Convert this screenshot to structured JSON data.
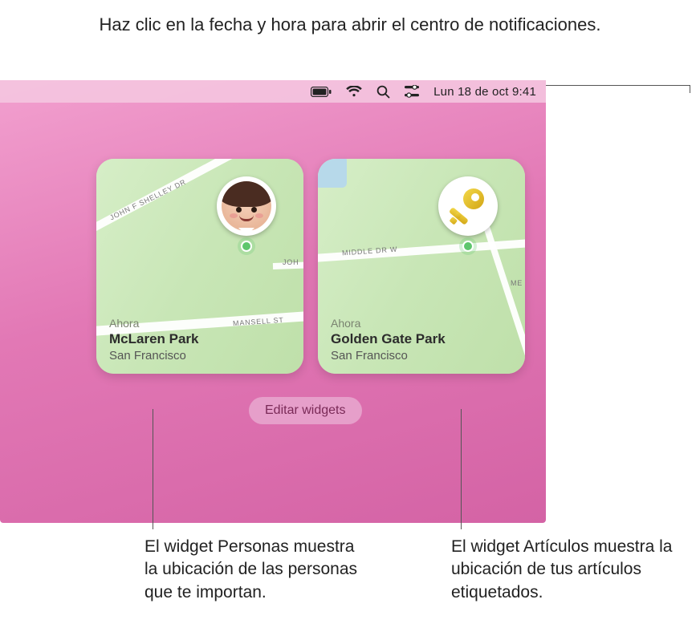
{
  "callouts": {
    "top": "Haz clic en la fecha y hora para abrir el centro de notificaciones.",
    "bottom_left": "El widget Personas muestra la ubicación de las personas que te importan.",
    "bottom_right": "El widget Artículos muestra la ubicación de tus artículos etiquetados."
  },
  "menubar": {
    "datetime": "Lun 18 de oct  9:41",
    "icons": {
      "battery": "battery-icon",
      "wifi": "wifi-icon",
      "search": "search-icon",
      "control_center": "control-center-icon"
    }
  },
  "widgets": {
    "people": {
      "now_label": "Ahora",
      "place": "McLaren Park",
      "city": "San Francisco",
      "roads": {
        "r1": "JOHN F SHELLEY DR",
        "r2": "MANSELL ST",
        "r3": "JOH"
      },
      "pin_icon": "memoji-person-icon"
    },
    "items": {
      "now_label": "Ahora",
      "place": "Golden Gate Park",
      "city": "San Francisco",
      "roads": {
        "r1": "MIDDLE DR W",
        "r2": "ME"
      },
      "pin_icon": "key-icon"
    }
  },
  "edit_button": "Editar widgets",
  "colors": {
    "desktop": "#e278b5",
    "map": "#cde8be",
    "pill_bg": "#e7a4cd",
    "pill_text": "#7a2a57"
  }
}
